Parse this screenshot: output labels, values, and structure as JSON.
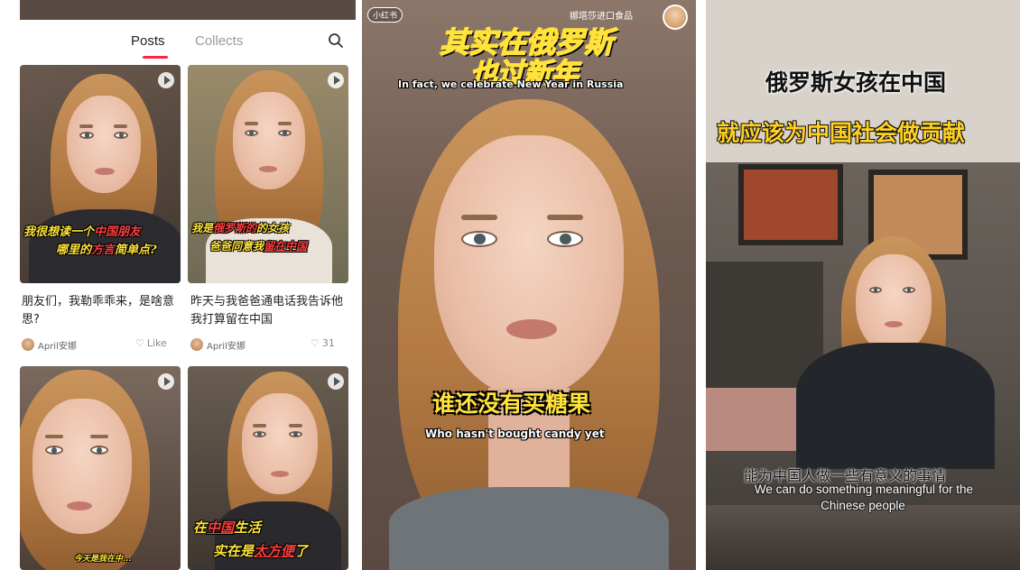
{
  "feed": {
    "tabs": [
      {
        "label": "Posts",
        "active": true
      },
      {
        "label": "Collects",
        "active": false
      }
    ],
    "accent_color": "#ff2442",
    "search_icon": "search-icon",
    "posts": [
      {
        "caption_line1_a": "我很想读一个",
        "caption_line1_b": "中国朋友",
        "caption_line2_a": "哪里的",
        "caption_line2_b": "方言",
        "caption_line2_c": "简单点?",
        "title": "朋友们，我勒乖乖来，是啥意思?",
        "author": "April安娜",
        "like_label": "Like"
      },
      {
        "caption_line1_a": "我是",
        "caption_line1_b": "俄罗斯的",
        "caption_line1_c": "的女孩",
        "caption_line2_a": "爸爸同意我",
        "caption_line2_b": "留在中国",
        "title": "昨天与我爸爸通电话我告诉他我打算留在中国",
        "author": "April安娜",
        "like_count": "31"
      },
      {
        "caption": "今天是我在中..."
      },
      {
        "caption_line1_a": "在",
        "caption_line1_b": "中国",
        "caption_line1_c": "生活",
        "caption_line2_a": "实在是",
        "caption_line2_b": "太方便",
        "caption_line2_c": "了"
      }
    ]
  },
  "video_center": {
    "logo": "小红书",
    "shop_name": "娜塔莎进口食品",
    "title_line1": "其实在俄罗斯",
    "title_line2": "也过新年",
    "subtitle_en_top": "In fact, we celebrate New Year in Russia",
    "caption_cn": "谁还没有买糖果",
    "caption_en": "Who hasn't bought candy yet"
  },
  "video_right": {
    "headline_1": "俄罗斯女孩在中国",
    "headline_2": "就应该为中国社会做贡献",
    "caption_cn": "能为中国人做一些有意义的事情",
    "caption_en_1": "We can do something meaningful for the",
    "caption_en_2": "Chinese people"
  }
}
